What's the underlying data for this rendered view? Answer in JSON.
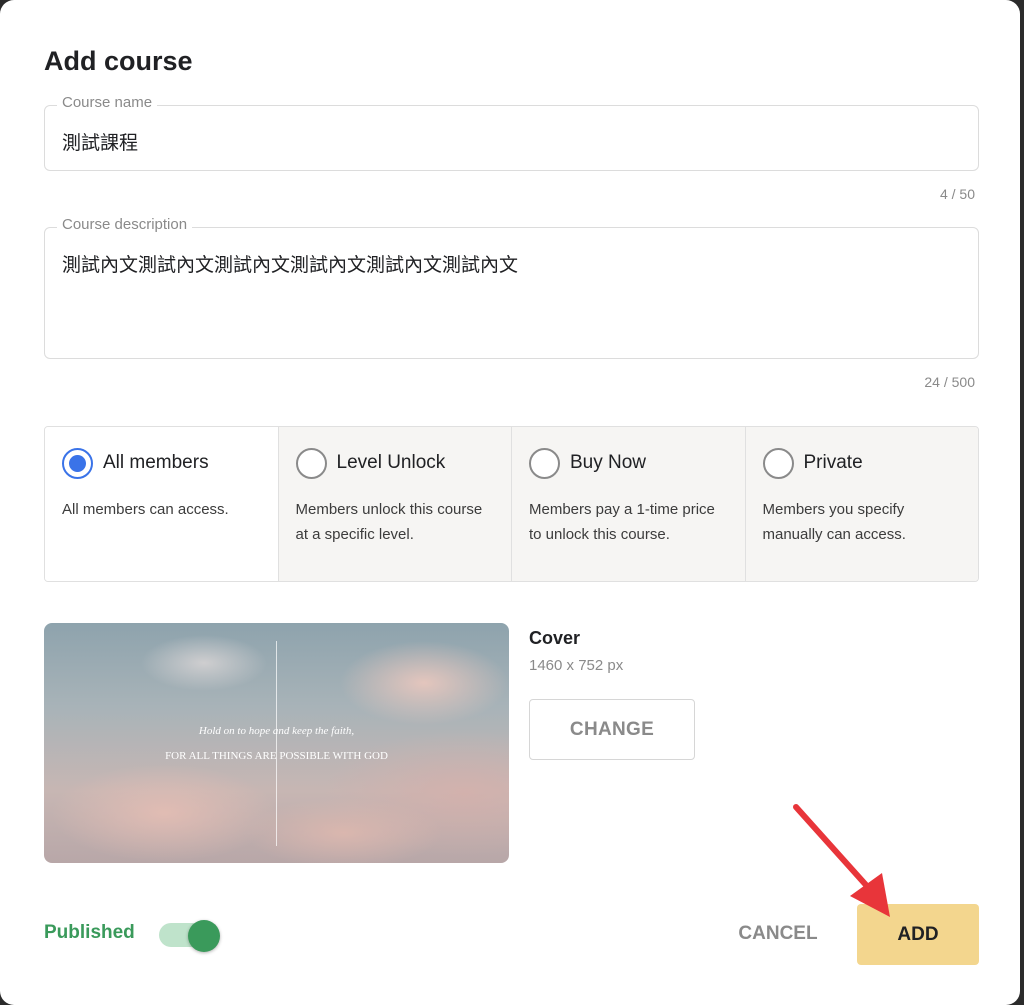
{
  "dialog": {
    "title": "Add course"
  },
  "course_name": {
    "label": "Course name",
    "value": "測試課程",
    "counter": "4 / 50"
  },
  "course_description": {
    "label": "Course description",
    "value": "測試內文測試內文測試內文測試內文測試內文測試內文",
    "counter": "24 / 500"
  },
  "access_options": [
    {
      "label": "All members",
      "description": "All members can access.",
      "selected": true
    },
    {
      "label": "Level Unlock",
      "description": "Members unlock this course at a specific level.",
      "selected": false
    },
    {
      "label": "Buy Now",
      "description": "Members pay a 1-time price to unlock this course.",
      "selected": false
    },
    {
      "label": "Private",
      "description": "Members you specify manually can access.",
      "selected": false
    }
  ],
  "cover": {
    "title": "Cover",
    "size": "1460 x 752 px",
    "image_text_line1": "Hold on to hope and keep the faith,",
    "image_text_line2": "FOR ALL THINGS ARE POSSIBLE WITH GOD",
    "change_label": "CHANGE"
  },
  "footer": {
    "published_label": "Published",
    "published_on": true,
    "cancel_label": "CANCEL",
    "add_label": "ADD"
  },
  "colors": {
    "accent_blue": "#3a73e8",
    "published_green": "#3a9a5b",
    "add_button": "#f3d68e",
    "annotation_arrow": "#e8353a"
  }
}
